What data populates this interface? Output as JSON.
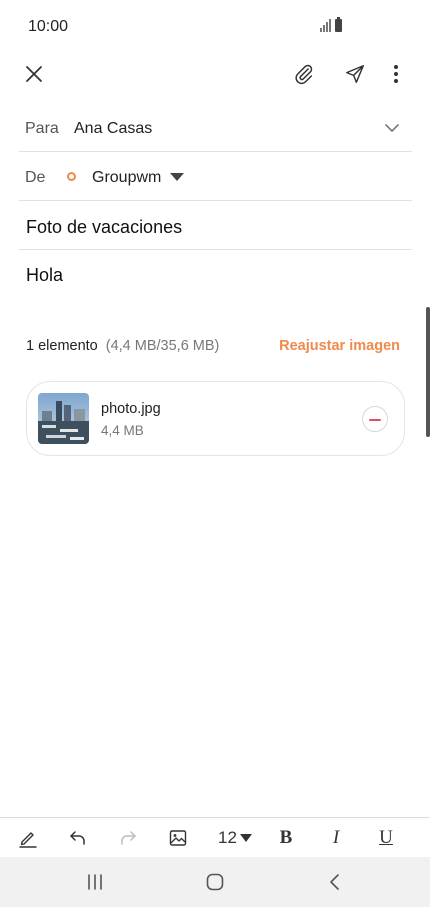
{
  "status_bar": {
    "time": "10:00"
  },
  "toolbar": {
    "close_icon": "close-icon",
    "attach_icon": "paperclip-icon",
    "send_icon": "send-icon",
    "more_icon": "more-vertical-icon"
  },
  "compose": {
    "to_label": "Para",
    "to_value": "Ana Casas",
    "from_label": "De",
    "from_value": "Groupwm",
    "subject": "Foto de vacaciones",
    "body": "Hola"
  },
  "attachments": {
    "count_text": "1 elemento",
    "size_text": "(4,4 MB/35,6 MB)",
    "resize_label": "Reajustar imagen",
    "items": [
      {
        "name": "photo.jpg",
        "size": "4,4 MB"
      }
    ]
  },
  "format_bar": {
    "font_size": "12",
    "bold_label": "B",
    "italic_label": "I",
    "underline_label": "U"
  },
  "colors": {
    "accent": "#f08a4b",
    "remove": "#e0505a",
    "divider": "#e2e2e2"
  }
}
